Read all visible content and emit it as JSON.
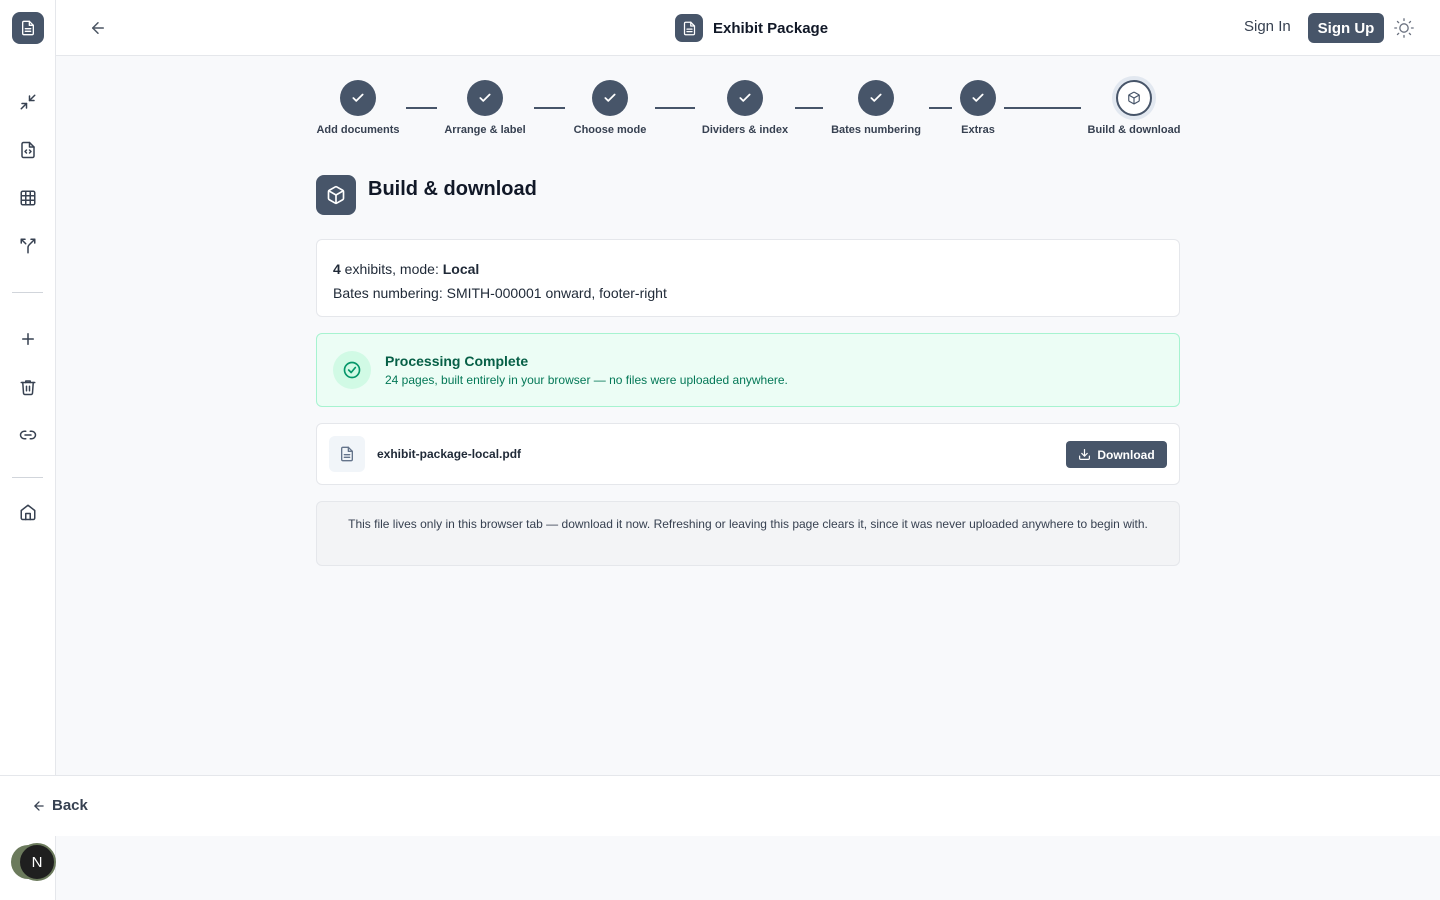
{
  "app": {
    "title": "Exhibit Package"
  },
  "header": {
    "sign_in": "Sign In",
    "sign_up": "Sign Up"
  },
  "steps": [
    {
      "label": "Add documents",
      "state": "done"
    },
    {
      "label": "Arrange & label",
      "state": "done"
    },
    {
      "label": "Choose mode",
      "state": "done"
    },
    {
      "label": "Dividers & index",
      "state": "done"
    },
    {
      "label": "Bates numbering",
      "state": "done"
    },
    {
      "label": "Extras",
      "state": "done"
    },
    {
      "label": "Build & download",
      "state": "current"
    }
  ],
  "section": {
    "title": "Build & download"
  },
  "summary": {
    "exhibit_count": "4",
    "exhibits_text": " exhibits, mode: ",
    "mode": "Local",
    "bates_line": "Bates numbering: SMITH-000001 onward, footer-right"
  },
  "status": {
    "title": "Processing Complete",
    "message": "24 pages, built entirely in your browser — no files were uploaded anywhere."
  },
  "file": {
    "name": "exhibit-package-local.pdf",
    "download_label": "Download"
  },
  "note": {
    "text": "This file lives only in this browser tab — download it now. Refreshing or leaving this page clears it, since it was never uploaded anywhere to begin with."
  },
  "footer": {
    "back_label": "Back"
  },
  "user": {
    "initial": "N"
  },
  "colors": {
    "primary": "#475569",
    "success_bg": "#ecfdf5",
    "success_text": "#065f46"
  }
}
